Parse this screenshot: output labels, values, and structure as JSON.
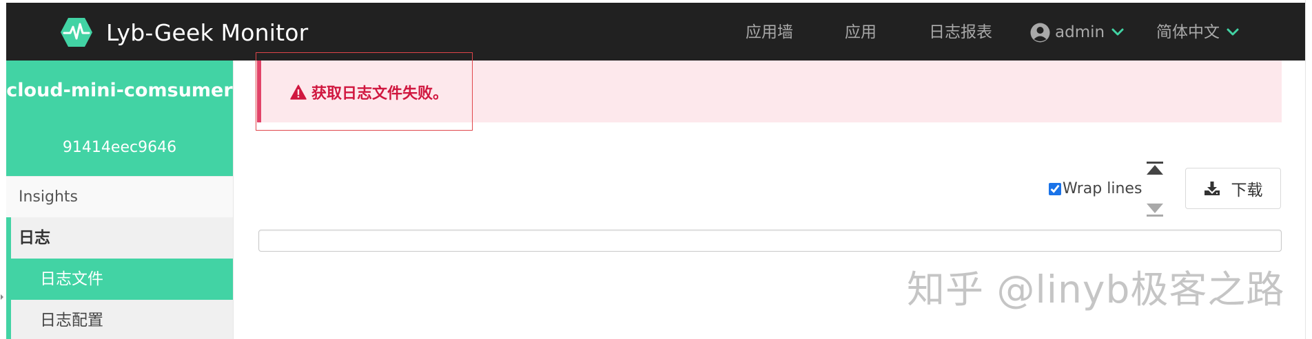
{
  "header": {
    "brand": "Lyb-Geek Monitor",
    "nav": {
      "wall": "应用墙",
      "apps": "应用",
      "report": "日志报表",
      "user": "admin",
      "language": "简体中文"
    }
  },
  "sidebar": {
    "app_name": "cloud-mini-comsumer",
    "instance_id": "91414eec9646",
    "items": {
      "insights": "Insights",
      "logs_group": "日志",
      "log_file": "日志文件",
      "log_config": "日志配置"
    }
  },
  "alert": {
    "message": "获取日志文件失败。"
  },
  "toolbar": {
    "wrap_lines_label": "Wrap lines",
    "wrap_lines_checked": true,
    "download_label": "下载"
  },
  "watermark": "知乎 @linyb极客之路",
  "colors": {
    "navbar": "#212121",
    "accent": "#42d3a4",
    "alert_bg": "#fde8ec",
    "alert_text": "#d0173f"
  },
  "icons": {
    "brand": "heartbeat-hexagon-icon",
    "user": "user-circle-icon",
    "dropdown": "chevron-down-icon",
    "warning": "warning-triangle-icon",
    "scroll_top": "scroll-to-top-icon",
    "scroll_bottom": "scroll-to-bottom-icon",
    "download": "download-icon"
  }
}
